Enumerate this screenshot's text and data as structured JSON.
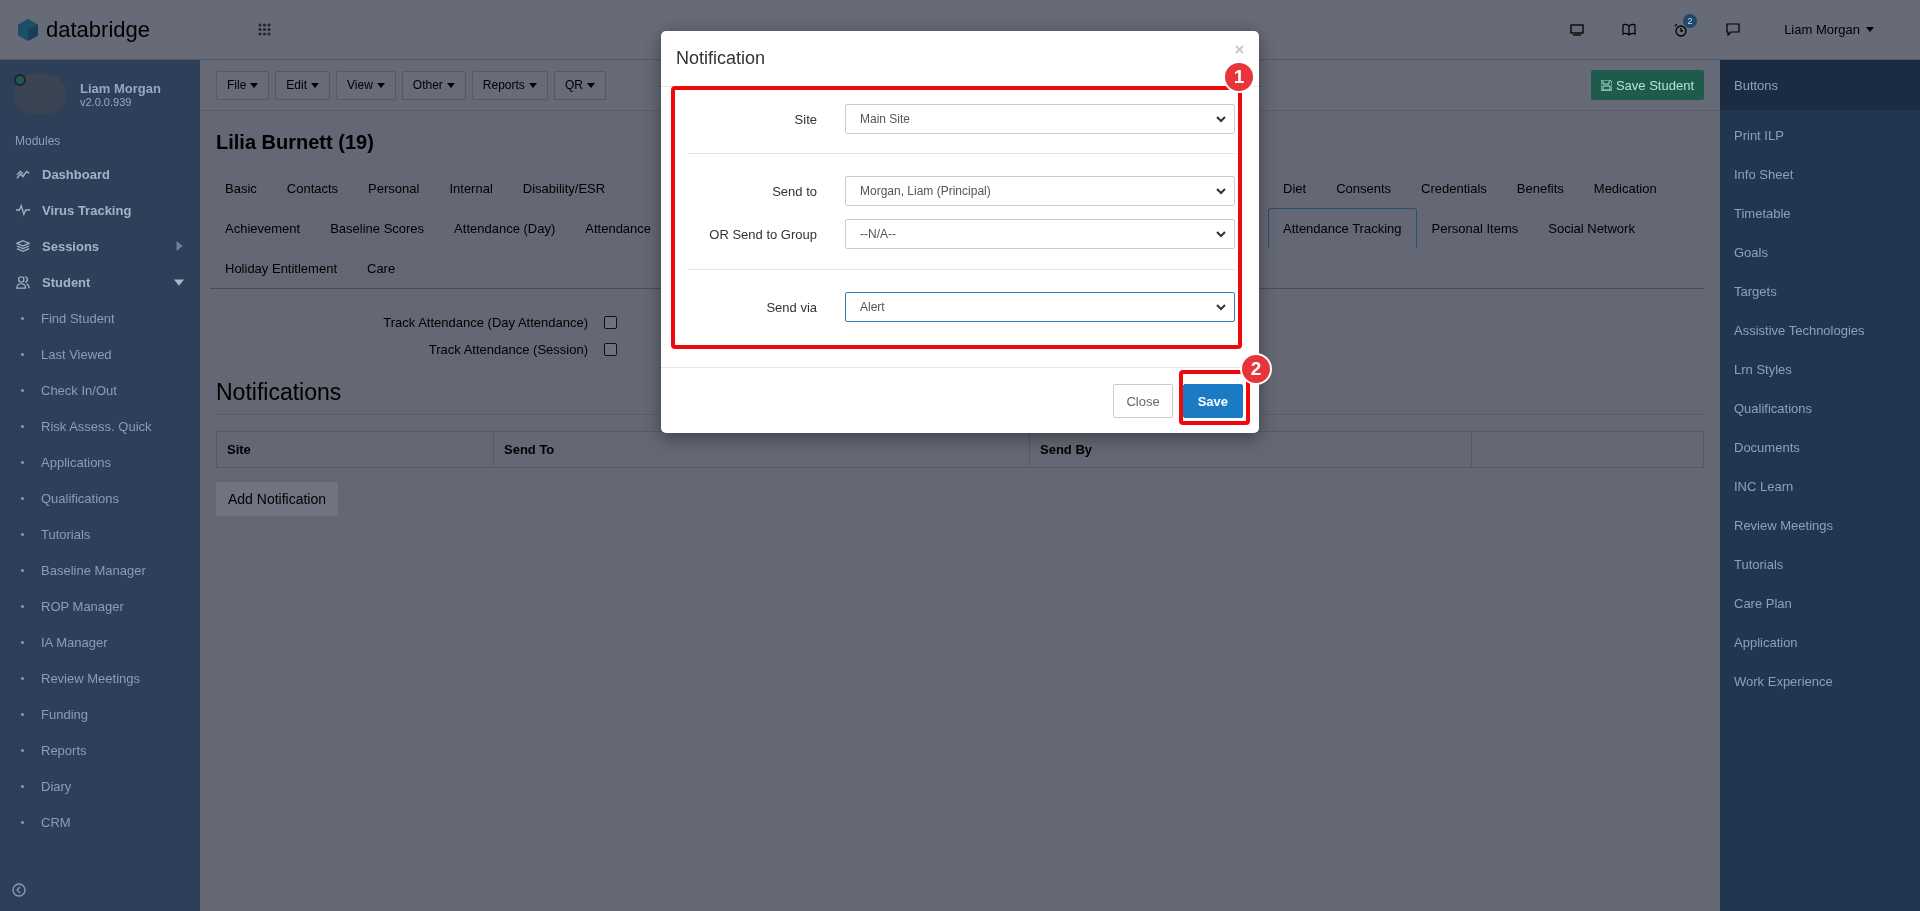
{
  "header": {
    "logo": "databridge",
    "notification_count": "2",
    "user_menu": "Liam Morgan"
  },
  "sidebar": {
    "user": {
      "name": "Liam Morgan",
      "version": "v2.0.0.939"
    },
    "section": "Modules",
    "items": [
      {
        "label": "Dashboard",
        "kind": "module"
      },
      {
        "label": "Virus Tracking",
        "kind": "module"
      },
      {
        "label": "Sessions",
        "kind": "module",
        "expanded": false
      },
      {
        "label": "Student",
        "kind": "module",
        "expanded": true
      },
      {
        "label": "Find Student",
        "kind": "sub"
      },
      {
        "label": "Last Viewed",
        "kind": "sub"
      },
      {
        "label": "Check In/Out",
        "kind": "sub"
      },
      {
        "label": "Risk Assess. Quick",
        "kind": "sub"
      },
      {
        "label": "Applications",
        "kind": "sub"
      },
      {
        "label": "Qualifications",
        "kind": "sub"
      },
      {
        "label": "Tutorials",
        "kind": "sub"
      },
      {
        "label": "Baseline Manager",
        "kind": "sub"
      },
      {
        "label": "ROP Manager",
        "kind": "sub"
      },
      {
        "label": "IA Manager",
        "kind": "sub"
      },
      {
        "label": "Review Meetings",
        "kind": "sub"
      },
      {
        "label": "Funding",
        "kind": "sub"
      },
      {
        "label": "Reports",
        "kind": "sub"
      },
      {
        "label": "Diary",
        "kind": "sub"
      },
      {
        "label": "CRM",
        "kind": "sub"
      }
    ]
  },
  "toolbar": {
    "menus": [
      "File",
      "Edit",
      "View",
      "Other",
      "Reports",
      "QR"
    ],
    "save_button": "Save Student"
  },
  "student_title": "Lilia Burnett (19)",
  "tab_rows": [
    {
      "left": [
        {
          "label": "Basic",
          "selected": false
        },
        {
          "label": "Contacts",
          "selected": false
        },
        {
          "label": "Personal",
          "selected": false
        },
        {
          "label": "Internal",
          "selected": false
        },
        {
          "label": "Disability/ESR",
          "selected": false
        }
      ],
      "right": [
        {
          "label": "Diet",
          "selected": false
        },
        {
          "label": "Consents",
          "selected": false
        },
        {
          "label": "Credentials",
          "selected": false
        },
        {
          "label": "Benefits",
          "selected": false
        },
        {
          "label": "Medication",
          "selected": false
        }
      ]
    },
    {
      "left": [
        {
          "label": "Achievement",
          "selected": false
        },
        {
          "label": "Baseline Scores",
          "selected": false
        },
        {
          "label": "Attendance (Day)",
          "selected": false
        },
        {
          "label": "Attendance",
          "selected": false
        }
      ],
      "right": [
        {
          "label": "Attendance Tracking",
          "selected": true
        },
        {
          "label": "Personal Items",
          "selected": false
        },
        {
          "label": "Social Network",
          "selected": false
        }
      ]
    },
    {
      "left": [
        {
          "label": "Holiday Entitlement",
          "selected": false
        },
        {
          "label": "Care",
          "selected": false
        }
      ],
      "right": []
    }
  ],
  "tracking": [
    {
      "label": "Track Attendance (Day Attendance)",
      "checked": false
    },
    {
      "label": "Track Attendance (Session)",
      "checked": false
    }
  ],
  "notifications": {
    "heading": "Notifications",
    "columns": [
      "Site",
      "Send To",
      "Send By"
    ],
    "add_button": "Add Notification"
  },
  "right_panel": {
    "heading": "Buttons",
    "items": [
      "Print ILP",
      "Info Sheet",
      "Timetable",
      "Goals",
      "Targets",
      "Assistive Technologies",
      "Lrn Styles",
      "Qualifications",
      "Documents",
      "INC Learn",
      "Review Meetings",
      "Tutorials",
      "Care Plan",
      "Application",
      "Work Experience"
    ]
  },
  "dialog": {
    "title": "Notification",
    "groups": [
      [
        {
          "label": "Site",
          "value": "Main Site",
          "focused": false
        }
      ],
      [
        {
          "label": "Send to",
          "value": "Morgan, Liam (Principal)",
          "focused": false
        },
        {
          "label": "OR Send to Group",
          "value": "--N/A--",
          "focused": false
        }
      ],
      [
        {
          "label": "Send via",
          "value": "Alert",
          "focused": true
        }
      ]
    ],
    "buttons": [
      {
        "label": "Close",
        "kind": "default"
      },
      {
        "label": "Save",
        "kind": "primary"
      }
    ],
    "callouts": [
      "1",
      "2"
    ]
  }
}
